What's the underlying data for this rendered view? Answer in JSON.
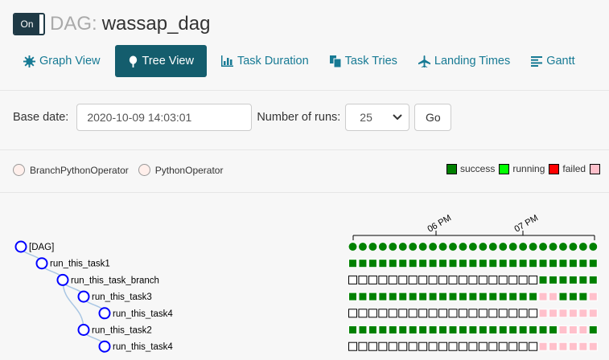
{
  "header": {
    "toggle": "On",
    "dag_prefix": "DAG:",
    "dag_name": "wassap_dag"
  },
  "tabs": [
    {
      "label": "Graph View",
      "icon": "graph-icon",
      "active": false
    },
    {
      "label": "Tree View",
      "icon": "tree-icon",
      "active": true
    },
    {
      "label": "Task Duration",
      "icon": "bar-chart-icon",
      "active": false
    },
    {
      "label": "Task Tries",
      "icon": "duplicate-icon",
      "active": false
    },
    {
      "label": "Landing Times",
      "icon": "plane-icon",
      "active": false
    },
    {
      "label": "Gantt",
      "icon": "align-left-icon",
      "active": false
    }
  ],
  "form": {
    "base_date_label": "Base date:",
    "base_date_value": "2020-10-09 14:03:01",
    "runs_label": "Number of runs:",
    "runs_value": "25",
    "go_label": "Go"
  },
  "operators": [
    {
      "label": "BranchPythonOperator"
    },
    {
      "label": "PythonOperator"
    }
  ],
  "states": [
    {
      "label": "success",
      "color": "#008000"
    },
    {
      "label": "running",
      "color": "#00ff00"
    },
    {
      "label": "failed",
      "color": "#ff0000"
    },
    {
      "label": "",
      "color": "#ffc0cb"
    }
  ],
  "colors": {
    "success": "#008000",
    "skipped": "#ffc0cb",
    "empty": "#ffffff",
    "node": "#0000ff",
    "link": "#a9c6e3"
  },
  "time_axis": {
    "ticks": [
      "06 PM",
      "07 PM"
    ]
  },
  "tree": {
    "nodes": [
      {
        "label": "[DAG]",
        "depth": 0,
        "runs": "SSSSSSSSSSSSSSSSSSSSSSSSS"
      },
      {
        "label": "run_this_task1",
        "depth": 1,
        "runs": "SSSSSSSSSSSSSSSSSSSSSSSSS"
      },
      {
        "label": "run_this_task_branch",
        "depth": 2,
        "runs": "EEEEEEEEEEEEEEEEEEESSSSSS"
      },
      {
        "label": "run_this_task3",
        "depth": 3,
        "runs": "SSSSSSSSSSSSSSSSSSSKKSSSK"
      },
      {
        "label": "run_this_task4",
        "depth": 4,
        "runs": "EEEEEEEEEEEEEEEEEEEKKKKKK"
      },
      {
        "label": "run_this_task2",
        "depth": 3,
        "runs": "SSSSSSSSSSSSSSSSSSSSSKKKS"
      },
      {
        "label": "run_this_task4",
        "depth": 4,
        "runs": "EEEEEEEEEEEEEEEEEEEKKKKKK"
      }
    ]
  }
}
